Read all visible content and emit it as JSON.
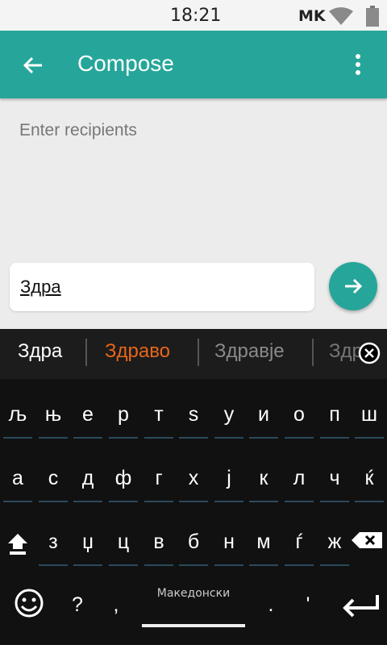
{
  "status": {
    "time": "18:21",
    "carrier": "MK"
  },
  "app": {
    "title": "Compose"
  },
  "recipients": {
    "placeholder": "Enter recipients"
  },
  "message": {
    "text": "Здра"
  },
  "suggestions": [
    "Здра",
    "Здраво",
    "Здравје",
    "Здра"
  ],
  "colors": {
    "accent": "#26a69a",
    "suggestion_highlight": "#e8661a",
    "keyboard_bg": "#111111"
  },
  "keyboard": {
    "row1": [
      "љ",
      "њ",
      "е",
      "р",
      "т",
      "ѕ",
      "у",
      "и",
      "о",
      "п",
      "ш"
    ],
    "row2": [
      "а",
      "с",
      "д",
      "ф",
      "г",
      "х",
      "ј",
      "к",
      "л",
      "ч",
      "ќ"
    ],
    "row3": [
      "з",
      "џ",
      "ц",
      "в",
      "б",
      "н",
      "м",
      "ѓ",
      "ж"
    ],
    "bottom": {
      "question": "?",
      "comma": ",",
      "language": "Македонски",
      "period": ".",
      "apostrophe": "'"
    }
  }
}
